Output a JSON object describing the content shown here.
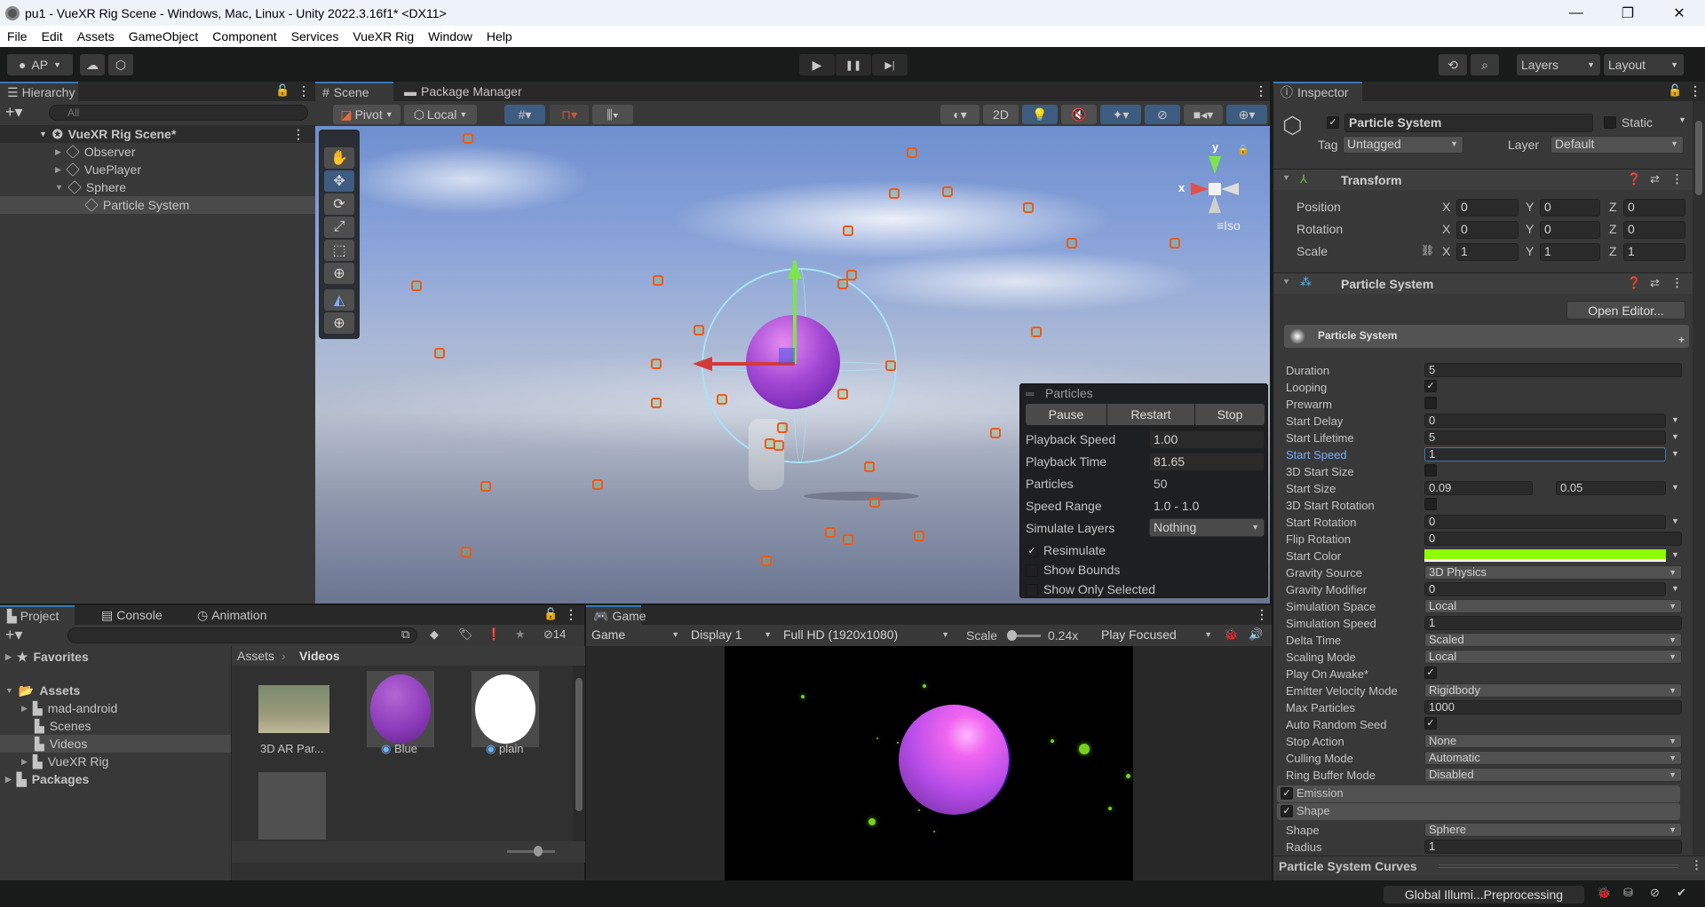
{
  "window": {
    "title": "pu1 - VueXR Rig Scene - Windows, Mac, Linux - Unity 2022.3.16f1* <DX11>",
    "minimize": "—",
    "maximize": "❐",
    "close": "✕"
  },
  "menu": [
    "File",
    "Edit",
    "Assets",
    "GameObject",
    "Component",
    "Services",
    "VueXR Rig",
    "Window",
    "Help"
  ],
  "toolbar": {
    "account": "AP",
    "play": "▶",
    "pause": "❚❚",
    "step": "▶|",
    "layers": "Layers",
    "layout": "Layout"
  },
  "hierarchy": {
    "tab": "Hierarchy",
    "search_placeholder": "All",
    "scene": "VueXR Rig Scene*",
    "items": [
      {
        "label": "Observer",
        "expanded": false
      },
      {
        "label": "VuePlayer",
        "expanded": false
      },
      {
        "label": "Sphere",
        "expanded": true
      },
      {
        "label": "Particle System",
        "selected": true
      }
    ]
  },
  "scene": {
    "tabs": [
      "Scene",
      "Package Manager"
    ],
    "pivot": "Pivot",
    "local": "Local",
    "mode_2d": "2D",
    "iso": "Iso",
    "axis_x": "x",
    "axis_y": "y"
  },
  "particles_overlay": {
    "title": "Particles",
    "buttons": [
      "Pause",
      "Restart",
      "Stop"
    ],
    "playback_speed_label": "Playback Speed",
    "playback_speed": "1.00",
    "playback_time_label": "Playback Time",
    "playback_time": "81.65",
    "particles_label": "Particles",
    "particles": "50",
    "speed_range_label": "Speed Range",
    "speed_range": "1.0 - 1.0",
    "simulate_layers_label": "Simulate Layers",
    "simulate_layers": "Nothing",
    "resimulate": "Resimulate",
    "show_bounds": "Show Bounds",
    "show_only_selected": "Show Only Selected"
  },
  "inspector": {
    "tab": "Inspector",
    "object_name": "Particle System",
    "static": "Static",
    "tag_label": "Tag",
    "tag": "Untagged",
    "layer_label": "Layer",
    "layer": "Default",
    "transform": {
      "title": "Transform",
      "rows": [
        {
          "label": "Position",
          "x": "0",
          "y": "0",
          "z": "0"
        },
        {
          "label": "Rotation",
          "x": "0",
          "y": "0",
          "z": "0"
        },
        {
          "label": "Scale",
          "x": "1",
          "y": "1",
          "z": "1"
        }
      ]
    },
    "ps_component": "Particle System",
    "open_editor": "Open Editor...",
    "ps_header": "Particle System",
    "props": {
      "duration": {
        "label": "Duration",
        "value": "5"
      },
      "looping": {
        "label": "Looping"
      },
      "prewarm": {
        "label": "Prewarm"
      },
      "start_delay": {
        "label": "Start Delay",
        "value": "0"
      },
      "start_lifetime": {
        "label": "Start Lifetime",
        "value": "5"
      },
      "start_speed": {
        "label": "Start Speed",
        "value": "1"
      },
      "start_size_3d": {
        "label": "3D Start Size"
      },
      "start_size": {
        "label": "Start Size",
        "min": "0.09",
        "max": "0.05"
      },
      "start_rotation_3d": {
        "label": "3D Start Rotation"
      },
      "start_rotation": {
        "label": "Start Rotation",
        "value": "0"
      },
      "flip_rotation": {
        "label": "Flip Rotation",
        "value": "0"
      },
      "start_color": {
        "label": "Start Color",
        "color": "#8fff00"
      },
      "gravity_source": {
        "label": "Gravity Source",
        "value": "3D Physics"
      },
      "gravity_modifier": {
        "label": "Gravity Modifier",
        "value": "0"
      },
      "simulation_space": {
        "label": "Simulation Space",
        "value": "Local"
      },
      "simulation_speed": {
        "label": "Simulation Speed",
        "value": "1"
      },
      "delta_time": {
        "label": "Delta Time",
        "value": "Scaled"
      },
      "scaling_mode": {
        "label": "Scaling Mode",
        "value": "Local"
      },
      "play_on_awake": {
        "label": "Play On Awake*"
      },
      "emitter_velocity_mode": {
        "label": "Emitter Velocity Mode",
        "value": "Rigidbody"
      },
      "max_particles": {
        "label": "Max Particles",
        "value": "1000"
      },
      "auto_random_seed": {
        "label": "Auto Random Seed"
      },
      "stop_action": {
        "label": "Stop Action",
        "value": "None"
      },
      "culling_mode": {
        "label": "Culling Mode",
        "value": "Automatic"
      },
      "ring_buffer_mode": {
        "label": "Ring Buffer Mode",
        "value": "Disabled"
      }
    },
    "modules": {
      "emission": "Emission",
      "shape": "Shape"
    },
    "shape_props": {
      "shape": {
        "label": "Shape",
        "value": "Sphere"
      },
      "radius": {
        "label": "Radius",
        "value": "1"
      }
    },
    "curves": "Particle System Curves"
  },
  "project": {
    "tabs": [
      "Project",
      "Console",
      "Animation"
    ],
    "hidden_count": "14",
    "tree": {
      "favorites": "Favorites",
      "assets": "Assets",
      "children": [
        "mad-android",
        "Scenes",
        "Videos",
        "VueXR Rig"
      ],
      "packages": "Packages"
    },
    "breadcrumb": [
      "Assets",
      "Videos"
    ],
    "files": [
      {
        "name": "3D AR Par..."
      },
      {
        "name": "Blue"
      },
      {
        "name": "plain"
      }
    ]
  },
  "game": {
    "tab": "Game",
    "mode": "Game",
    "display": "Display 1",
    "resolution": "Full HD (1920x1080)",
    "scale_label": "Scale",
    "scale_value": "0.24x",
    "play_focused": "Play Focused"
  },
  "status": {
    "text": "Global Illumi...Preprocessing"
  }
}
